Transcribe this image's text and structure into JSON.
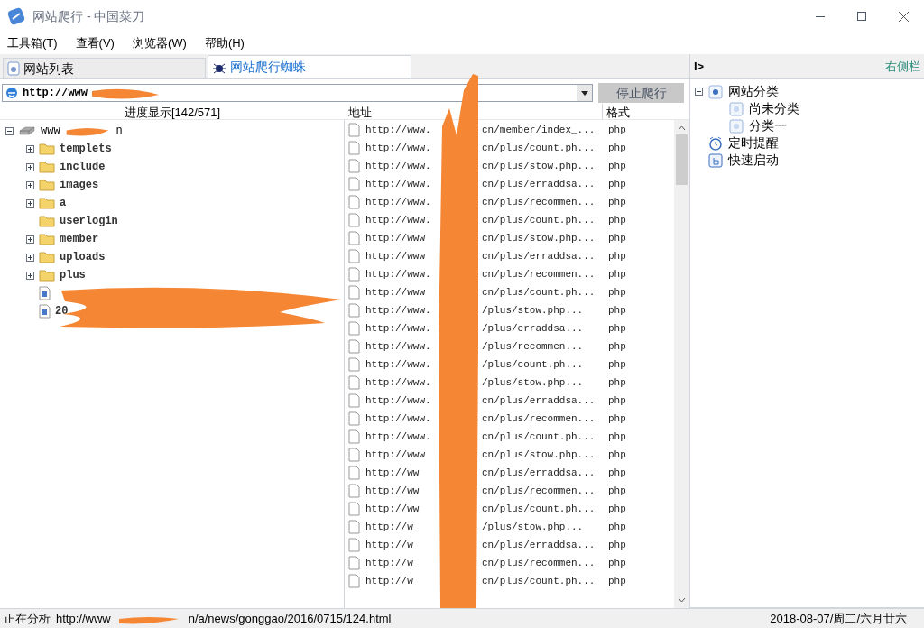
{
  "window": {
    "title": "网站爬行 - 中国菜刀"
  },
  "menu": [
    "工具箱(T)",
    "查看(V)",
    "浏览器(W)",
    "帮助(H)"
  ],
  "tabs": [
    {
      "label": "网站列表",
      "selected": false,
      "kind": "list"
    },
    {
      "label": "网站爬行蜘蛛",
      "selected": true,
      "kind": "spider"
    }
  ],
  "address_bar": {
    "value": "http://www"
  },
  "stop_button": {
    "label": "停止爬行",
    "disabled": true
  },
  "columns": {
    "progress": "进度显示[142/571]",
    "address": "地址",
    "format": "格式"
  },
  "tree": {
    "label": "www",
    "suffix": "n",
    "expanded": true,
    "children": [
      {
        "label": "templets",
        "kind": "folder",
        "expanded": false
      },
      {
        "label": "include",
        "kind": "folder",
        "expanded": false
      },
      {
        "label": "images",
        "kind": "folder",
        "expanded": false
      },
      {
        "label": "a",
        "kind": "folder",
        "expanded": false
      },
      {
        "label": "userlogin",
        "kind": "leaf_folder"
      },
      {
        "label": "member",
        "kind": "folder",
        "expanded": false
      },
      {
        "label": "uploads",
        "kind": "folder",
        "expanded": false
      },
      {
        "label": "plus",
        "kind": "folder",
        "expanded": false
      },
      {
        "kind": "file"
      },
      {
        "label": "20",
        "kind": "file"
      }
    ]
  },
  "rows": [
    {
      "prefix": "http://www.",
      "path": "cn/member/index_...",
      "format": "php"
    },
    {
      "prefix": "http://www.",
      "path": "cn/plus/count.ph...",
      "format": "php"
    },
    {
      "prefix": "http://www.",
      "path": "cn/plus/stow.php...",
      "format": "php"
    },
    {
      "prefix": "http://www.",
      "path": "cn/plus/erraddsa...",
      "format": "php"
    },
    {
      "prefix": "http://www.",
      "path": "cn/plus/recommen...",
      "format": "php"
    },
    {
      "prefix": "http://www.",
      "path": "cn/plus/count.ph...",
      "format": "php"
    },
    {
      "prefix": "http://www",
      "path": "cn/plus/stow.php...",
      "format": "php"
    },
    {
      "prefix": "http://www",
      "path": "cn/plus/erraddsa...",
      "format": "php"
    },
    {
      "prefix": "http://www.",
      "path": "cn/plus/recommen...",
      "format": "php"
    },
    {
      "prefix": "http://www",
      "path": "cn/plus/count.ph...",
      "format": "php"
    },
    {
      "prefix": "http://www.",
      "path": "/plus/stow.php...",
      "format": "php"
    },
    {
      "prefix": "http://www.",
      "path": "/plus/erraddsa...",
      "format": "php"
    },
    {
      "prefix": "http://www.",
      "path": "/plus/recommen...",
      "format": "php"
    },
    {
      "prefix": "http://www.",
      "path": "/plus/count.ph...",
      "format": "php"
    },
    {
      "prefix": "http://www.",
      "path": "/plus/stow.php...",
      "format": "php"
    },
    {
      "prefix": "http://www.",
      "path": "cn/plus/erraddsa...",
      "format": "php"
    },
    {
      "prefix": "http://www.",
      "path": "cn/plus/recommen...",
      "format": "php"
    },
    {
      "prefix": "http://www.",
      "path": "cn/plus/count.ph...",
      "format": "php"
    },
    {
      "prefix": "http://www",
      "path": "cn/plus/stow.php...",
      "format": "php"
    },
    {
      "prefix": "http://ww",
      "path": "cn/plus/erraddsa...",
      "format": "php"
    },
    {
      "prefix": "http://ww",
      "path": "cn/plus/recommen...",
      "format": "php"
    },
    {
      "prefix": "http://ww",
      "path": "cn/plus/count.ph...",
      "format": "php"
    },
    {
      "prefix": "http://w",
      "path": "/plus/stow.php...",
      "format": "php"
    },
    {
      "prefix": "http://w",
      "path": "cn/plus/erraddsa...",
      "format": "php"
    },
    {
      "prefix": "http://w",
      "path": "cn/plus/recommen...",
      "format": "php"
    },
    {
      "prefix": "http://w",
      "path": "cn/plus/count.ph...",
      "format": "php"
    }
  ],
  "sidebar": {
    "toggle": "I>",
    "title": "右侧栏",
    "items": [
      {
        "label": "网站分类",
        "kind": "category",
        "expanded": true,
        "children": [
          {
            "label": "尚未分类",
            "kind": "sub"
          },
          {
            "label": "分类一",
            "kind": "sub"
          }
        ]
      },
      {
        "label": "定时提醒",
        "kind": "alarm"
      },
      {
        "label": "快速启动",
        "kind": "launch"
      }
    ]
  },
  "status_bar": {
    "label": "正在分析",
    "url_start": "http://www",
    "url_end": "n/a/news/gonggao/2016/0715/124.html",
    "date": "2018-08-07/周二/六月廿六"
  }
}
